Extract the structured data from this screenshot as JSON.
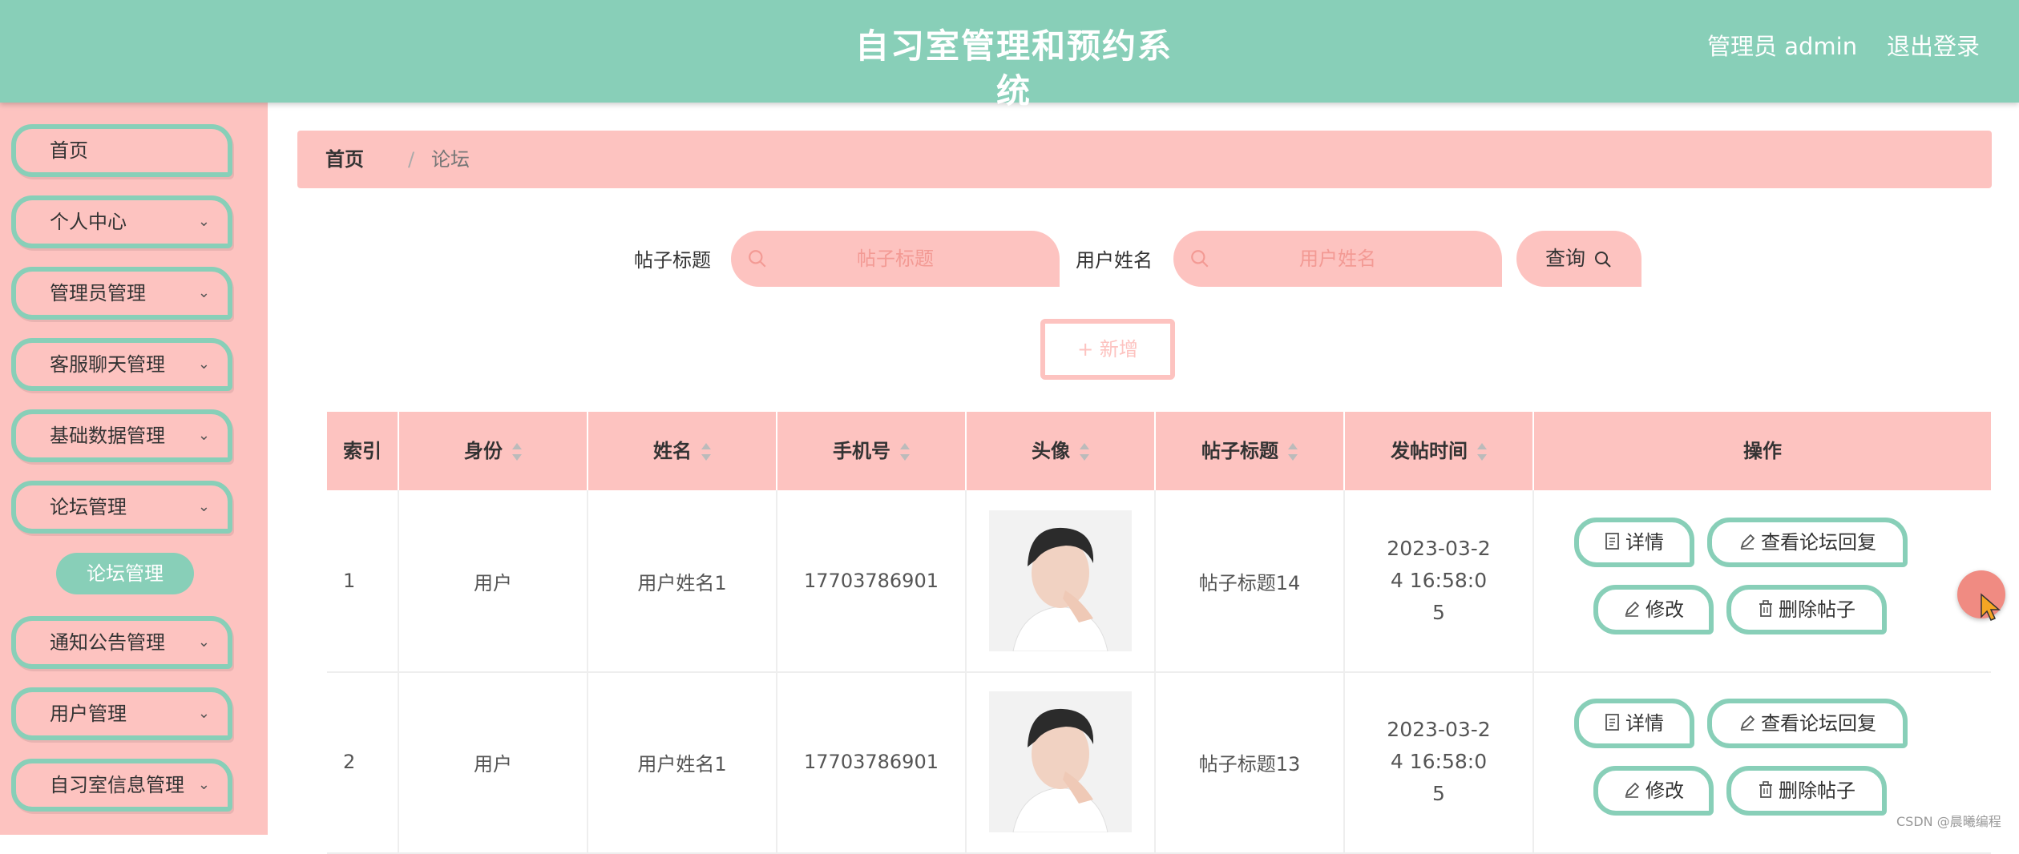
{
  "header": {
    "title": "自习室管理和预约系统",
    "user": "管理员 admin",
    "logout": "退出登录"
  },
  "sidebar": {
    "items": [
      {
        "label": "首页",
        "has_children": false
      },
      {
        "label": "个人中心",
        "has_children": true
      },
      {
        "label": "管理员管理",
        "has_children": true
      },
      {
        "label": "客服聊天管理",
        "has_children": true
      },
      {
        "label": "基础数据管理",
        "has_children": true
      },
      {
        "label": "论坛管理",
        "has_children": true,
        "expanded": true
      },
      {
        "label": "通知公告管理",
        "has_children": true
      },
      {
        "label": "用户管理",
        "has_children": true
      },
      {
        "label": "自习室信息管理",
        "has_children": true
      }
    ],
    "submenu_active": "论坛管理"
  },
  "breadcrumb": {
    "home": "首页",
    "separator": "/",
    "current": "论坛"
  },
  "search": {
    "title_label": "帖子标题",
    "title_placeholder": "帖子标题",
    "name_label": "用户姓名",
    "name_placeholder": "用户姓名",
    "query_label": "查询"
  },
  "add_button": "+ 新增",
  "table": {
    "headers": [
      "索引",
      "身份",
      "姓名",
      "手机号",
      "头像",
      "帖子标题",
      "发帖时间",
      "操作"
    ],
    "rows": [
      {
        "index": "1",
        "role": "用户",
        "name": "用户姓名1",
        "phone": "17703786901",
        "title": "帖子标题14",
        "time": "2023-03-24 16:58:05"
      },
      {
        "index": "2",
        "role": "用户",
        "name": "用户姓名1",
        "phone": "17703786901",
        "title": "帖子标题13",
        "time": "2023-03-24 16:58:05"
      }
    ],
    "actions": {
      "detail": "详情",
      "view_replies": "查看论坛回复",
      "edit": "修改",
      "delete": "删除帖子"
    }
  },
  "watermark": "CSDN @晨曦编程",
  "colors": {
    "header": "#88cfb8",
    "accent_pink": "#fdc3c0",
    "placeholder": "#f39a94"
  }
}
